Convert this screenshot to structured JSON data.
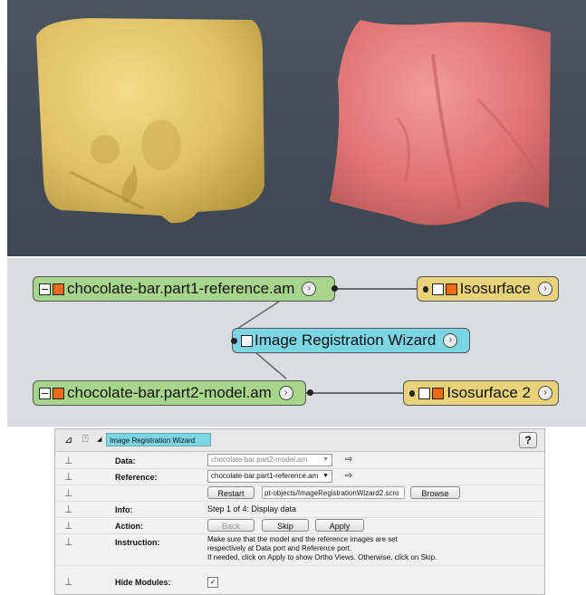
{
  "pool": {
    "node_reference": "chocolate-bar.part1-reference.am",
    "node_isosurface1": "Isosurface",
    "node_wizard": "Image Registration Wizard",
    "node_model": "chocolate-bar.part2-model.am",
    "node_isosurface2": "Isosurface 2"
  },
  "panel": {
    "title": "Image Registration Wizard",
    "help": "?",
    "data_label": "Data:",
    "data_value": "chocolate-bar.part2-model.am",
    "reference_label": "Reference:",
    "reference_value": "chocolate-bar.part1-reference.am",
    "restart": "Restart",
    "script_path": "pt-objects/ImageRegistrationWizard2.scro",
    "browse": "Browse",
    "info_label": "Info:",
    "info_value": "Step 1 of 4: Display data",
    "action_label": "Action:",
    "back": "Back",
    "skip": "Skip",
    "apply": "Apply",
    "instruction_label": "Instruction:",
    "instruction_line1": "Make sure that the model and the reference images are set",
    "instruction_line2": "respectively at Data port and Reference port.",
    "instruction_line3": "If needed, click on Apply to show Ortho Views. Otherwise, click on Skip.",
    "hide_modules_label": "Hide Modules:",
    "hide_modules_checked": "✓"
  },
  "colors": {
    "viewer_bg": "#444c57",
    "yellow_surface": "#e6c66a",
    "pink_surface": "#e37878",
    "green_node": "#a7d58b",
    "yellow_node": "#e8d27a",
    "blue_node": "#7cd6e6"
  }
}
